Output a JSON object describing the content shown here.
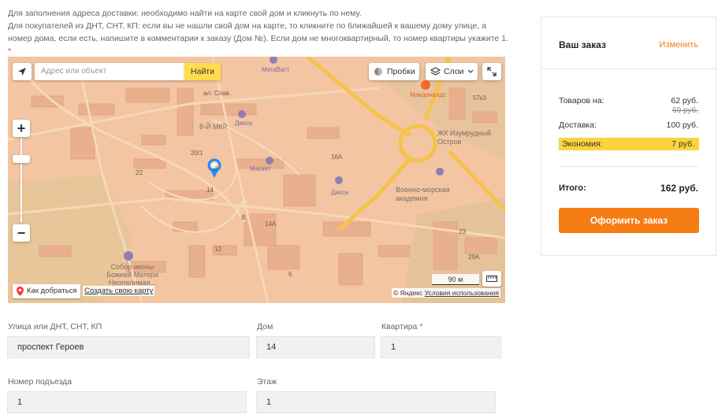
{
  "instructions": {
    "line1": "Для заполнения адреса доставки: необходимо найти на карте свой дом и кликнуть по нему.",
    "line2": "Для покупателей из ДНТ, СНТ, КП: если вы не нашли свой дом на карте, то кликните по ближайшей к вашему дому улице, а номер дома, если есть, напишите в комментарии к заказу (Дом №). Если дом не многоквартирный, то номер квартиры укажите 1.",
    "required_mark": "*"
  },
  "map": {
    "search_placeholder": "Адрес или объект",
    "search_button": "Найти",
    "traffic_label": "Пробки",
    "layers_label": "Слои",
    "route_label": "Как добраться",
    "make_map_label": "Создать свою карту",
    "copyright": "© Яндекс",
    "terms_label": "Условия использования",
    "scale_label": "90 м",
    "labels": {
      "megavatt": "МегаВатт",
      "street_slav": "ал. Слав.",
      "mkr": "8-Й МКР.",
      "diksi1": "Дикси",
      "diksi2": "Дикси",
      "magnit": "Магнит",
      "mcdonalds": "Макдоналдс",
      "zhk": "ЖК Изумрудный Остров",
      "naval": "Военно-морская академия",
      "sobor": "Собор иконы Божией Матери Неопалимая...",
      "h20": "20/1",
      "h14": "14",
      "h16a": "16А",
      "h14a": "14А",
      "h12": "12",
      "h8": "8",
      "h6": "6",
      "h22": "22",
      "h57": "57к3",
      "h29a": "29А",
      "h23": "23",
      "h2": "2"
    }
  },
  "form": {
    "street_label": "Улица или ДНТ, СНТ, КП",
    "street_value": "проспект Героев",
    "house_label": "Дом",
    "house_value": "14",
    "apartment_label": "Квартира",
    "apartment_value": "1",
    "entrance_label": "Номер подъезда",
    "entrance_value": "1",
    "floor_label": "Этаж",
    "floor_value": "1",
    "required_mark": "*"
  },
  "order": {
    "title": "Ваш заказ",
    "edit_label": "Изменить",
    "goods_label": "Товаров на:",
    "goods_value": "62 руб.",
    "goods_old_value": "69 руб.",
    "delivery_label": "Доставка:",
    "delivery_value": "100 руб.",
    "economy_label": "Экономия:",
    "economy_value": "7 руб.",
    "total_label": "Итого:",
    "total_value": "162 руб.",
    "checkout_label": "Оформить заказ"
  },
  "colors": {
    "accent": "#f57d14",
    "economy_bg": "#fcd33c",
    "map_bg": "#f3c5a2",
    "search_button": "#ffdb4d"
  }
}
